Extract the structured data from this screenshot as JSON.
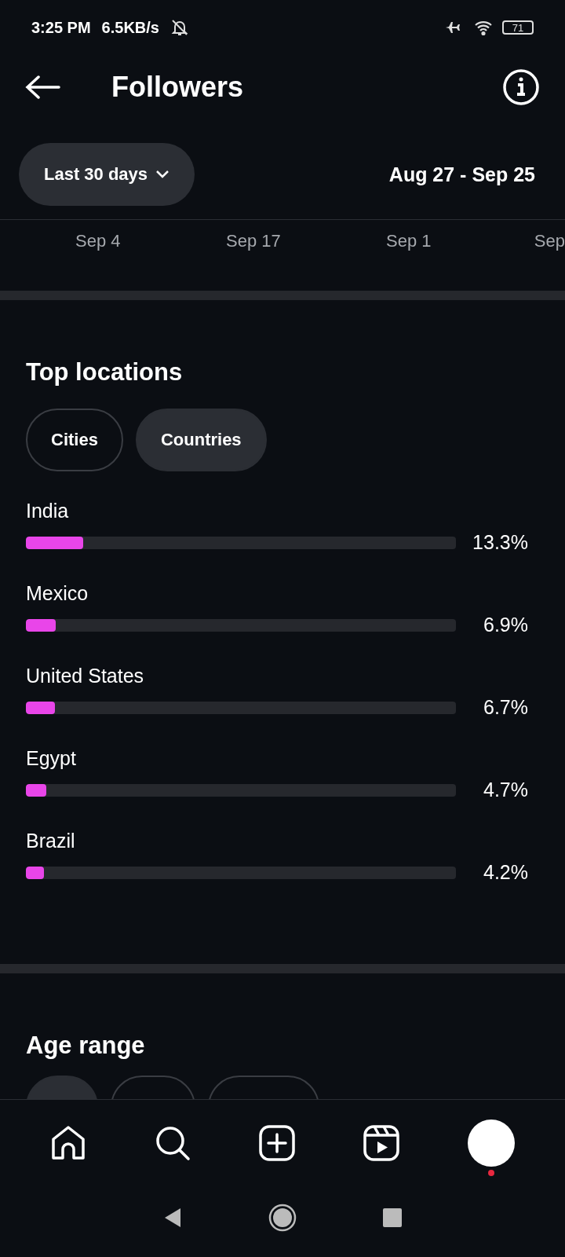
{
  "status_bar": {
    "time": "3:25 PM",
    "speed": "6.5KB/s",
    "battery": "71"
  },
  "header": {
    "title": "Followers"
  },
  "range": {
    "label": "Last 30 days",
    "dates": "Aug 27 - Sep 25"
  },
  "axis_labels": [
    "Sep 4",
    "Sep 17",
    "Sep 1",
    "Sep"
  ],
  "top_locations": {
    "title": "Top locations",
    "tabs": [
      {
        "label": "Cities",
        "selected": false
      },
      {
        "label": "Countries",
        "selected": true
      }
    ],
    "rows": [
      {
        "name": "India",
        "level": 0.133,
        "reading": "13.3%"
      },
      {
        "name": "Mexico",
        "level": 0.069,
        "reading": "6.9%"
      },
      {
        "name": "United States",
        "level": 0.067,
        "reading": "6.7%"
      },
      {
        "name": "Egypt",
        "level": 0.047,
        "reading": "4.7%"
      },
      {
        "name": "Brazil",
        "level": 0.042,
        "reading": "4.2%"
      }
    ]
  },
  "age_range": {
    "title": "Age range",
    "tabs": [
      {
        "selected": true
      },
      {
        "selected": false
      },
      {
        "selected": false
      }
    ]
  },
  "nav": {
    "profile_notification": true
  }
}
